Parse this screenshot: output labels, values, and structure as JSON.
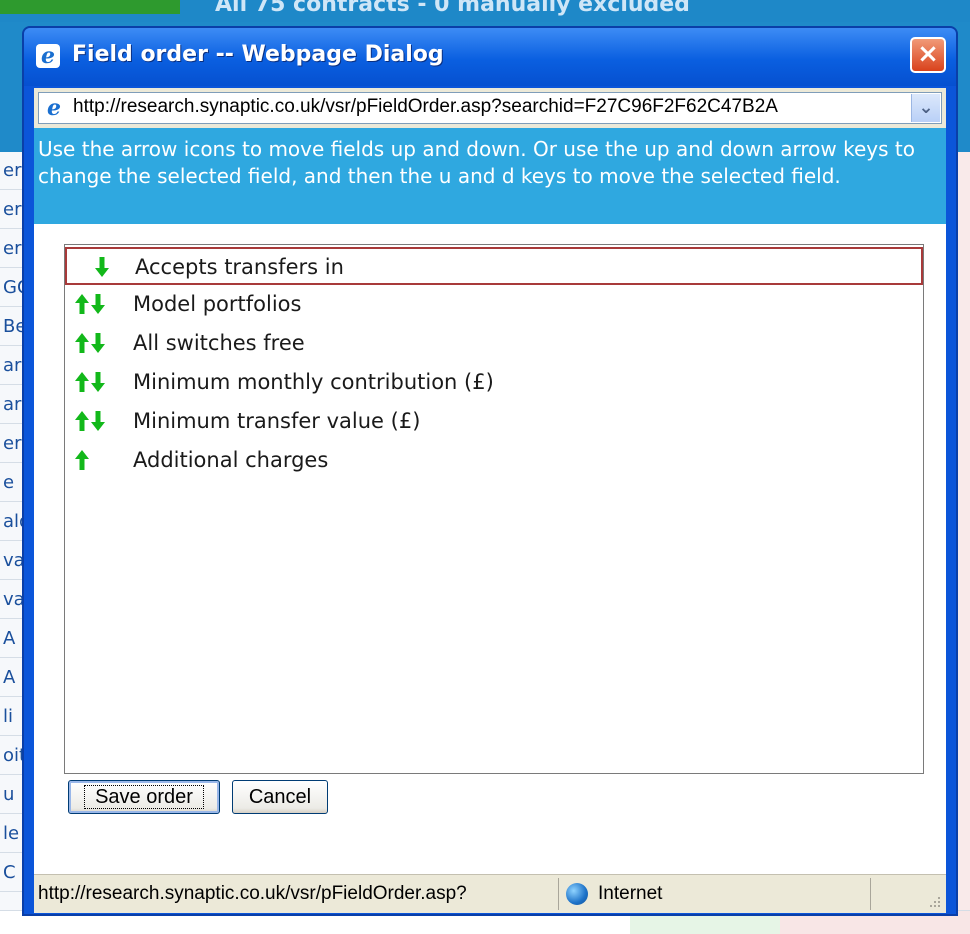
{
  "background_page": {
    "title": "All 75 contracts - 0 manually excluded",
    "row_fragments": [
      "er",
      "er",
      "er",
      "GO",
      "Be",
      "ar",
      "ar",
      "er",
      "e",
      "ald",
      "va",
      "va",
      "A",
      "A",
      "li",
      "oit",
      "u",
      "le",
      "C"
    ]
  },
  "dialog": {
    "title": "Field order -- Webpage Dialog",
    "close_symbol": "×",
    "address": "http://research.synaptic.co.uk/vsr/pFieldOrder.asp?searchid=F27C96F2F62C47B2A",
    "instructions": "Use the arrow icons to move fields up and down. Or use the up and down arrow keys to change the selected field, and then the u and d keys to move the selected field.",
    "fields": [
      {
        "label": "Accepts transfers in",
        "up": false,
        "down": true,
        "selected": true
      },
      {
        "label": "Model portfolios",
        "up": true,
        "down": true,
        "selected": false
      },
      {
        "label": "All switches free",
        "up": true,
        "down": true,
        "selected": false
      },
      {
        "label": "Minimum monthly contribution (£)",
        "up": true,
        "down": true,
        "selected": false
      },
      {
        "label": "Minimum transfer value (£)",
        "up": true,
        "down": true,
        "selected": false
      },
      {
        "label": "Additional charges",
        "up": true,
        "down": false,
        "selected": false
      }
    ],
    "buttons": {
      "save": "Save order",
      "cancel": "Cancel"
    },
    "status": {
      "url": "http://research.synaptic.co.uk/vsr/pFieldOrder.asp?",
      "zone": "Internet"
    }
  },
  "colors": {
    "arrow_green": "#12b81a",
    "titlebar_blue": "#0a5fe0",
    "info_blue": "#2fa8e0",
    "selected_border": "#a83a3a"
  }
}
